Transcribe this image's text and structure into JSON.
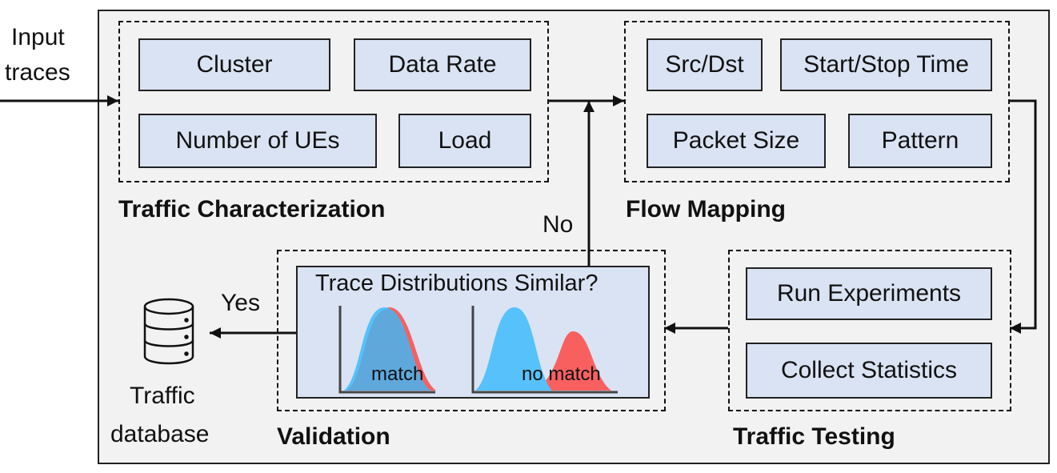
{
  "input_label_line1": "Input",
  "input_label_line2": "traces",
  "traffic_characterization": {
    "title": "Traffic Characterization",
    "items": [
      "Cluster",
      "Data Rate",
      "Number of UEs",
      "Load"
    ]
  },
  "flow_mapping": {
    "title": "Flow Mapping",
    "items": [
      "Src/Dst",
      "Start/Stop Time",
      "Packet Size",
      "Pattern"
    ]
  },
  "validation": {
    "title": "Validation",
    "question": "Trace Distributions Similar?",
    "match_label": "match",
    "no_match_label": "no match"
  },
  "traffic_testing": {
    "title": "Traffic Testing",
    "items": [
      "Run Experiments",
      "Collect Statistics"
    ]
  },
  "no_label": "No",
  "yes_label": "Yes",
  "database": {
    "icon": "database-icon",
    "line1": "Traffic",
    "line2": "database"
  },
  "colors": {
    "box_fill": "#dae3f3",
    "blue_dist": "#56c1fb",
    "red_dist": "#f86060",
    "overlap": "#5ea8dc"
  }
}
